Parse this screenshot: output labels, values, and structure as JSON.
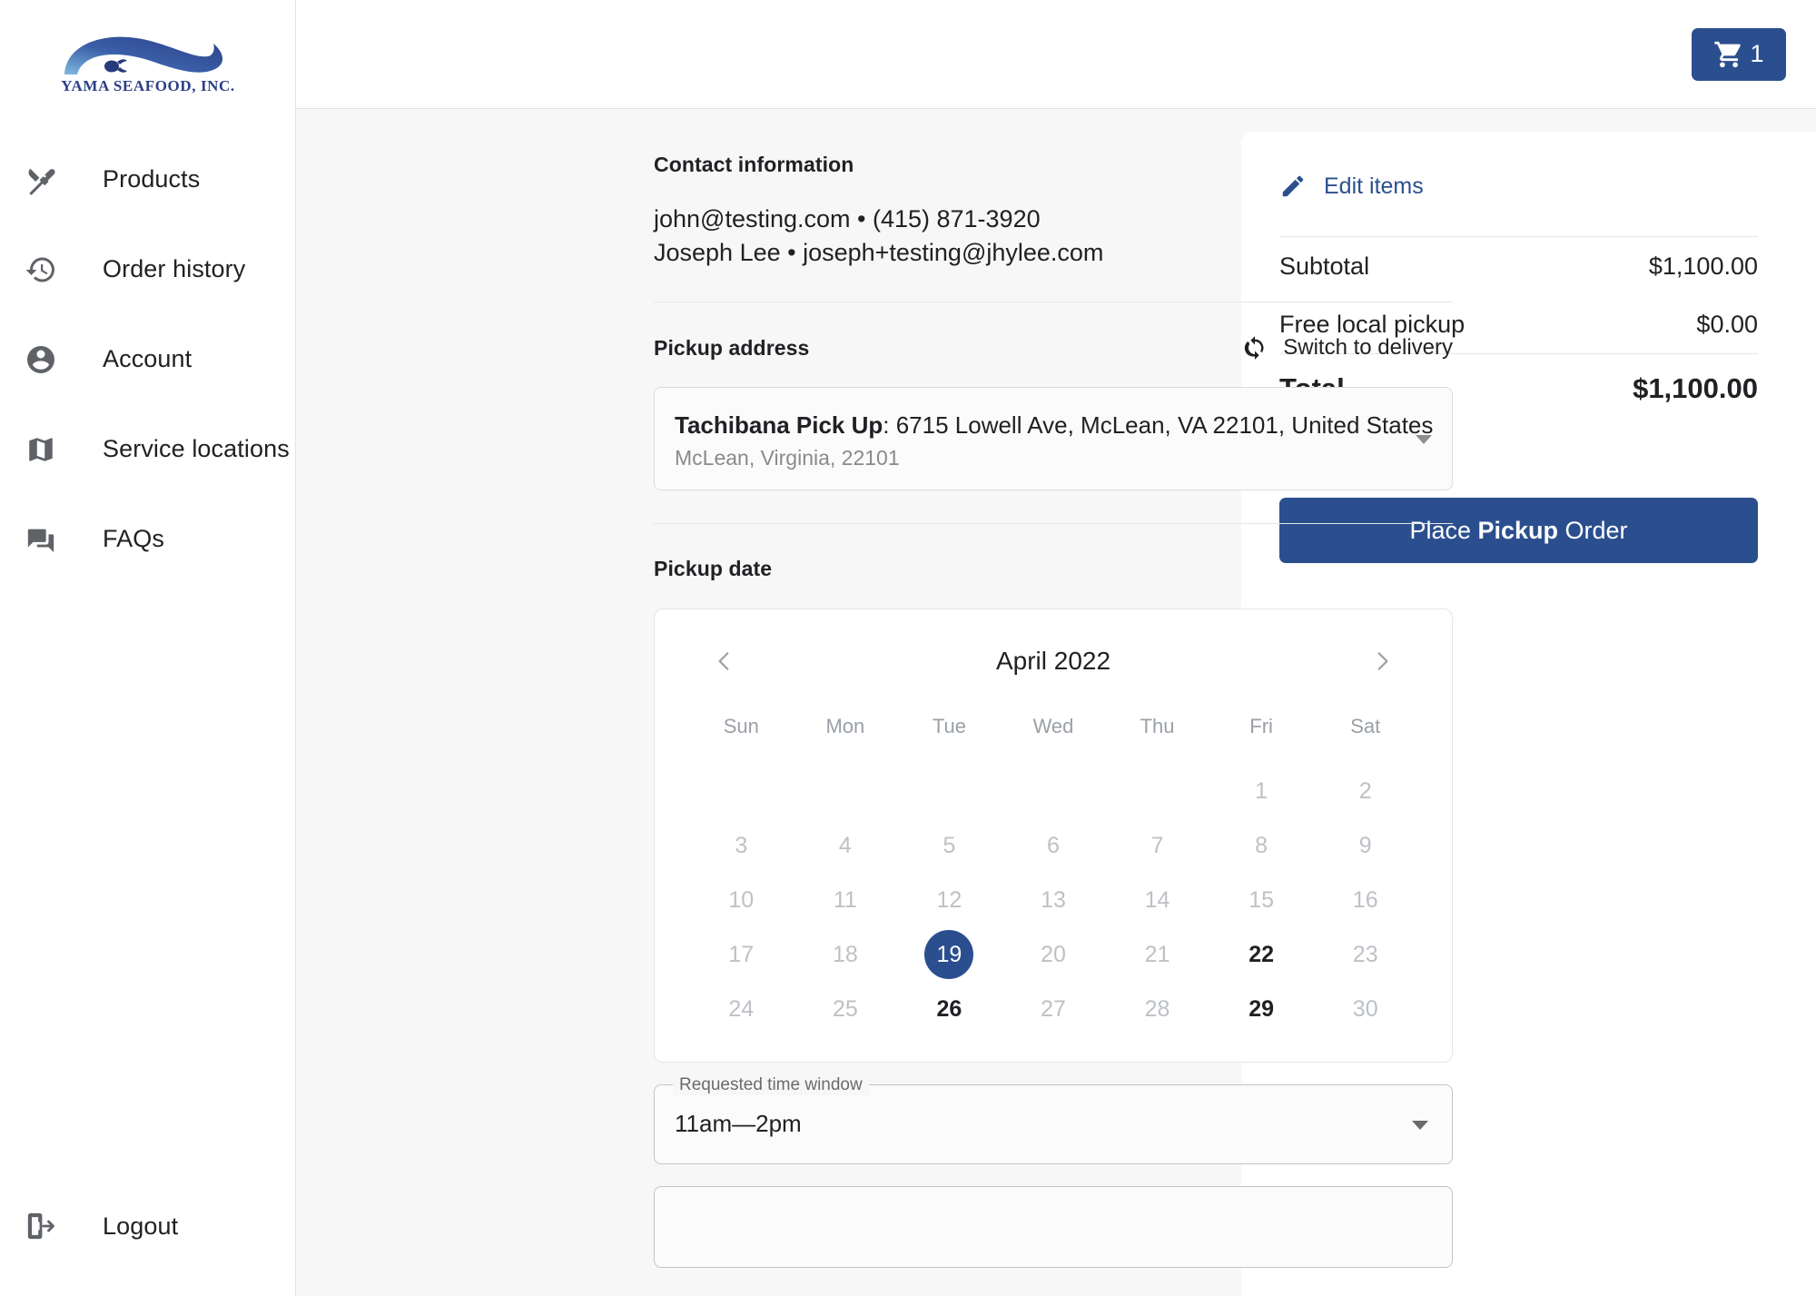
{
  "brand": {
    "logo_text": "YAMA SEAFOOD, INC.",
    "logo_icon": "fish-wave-logo",
    "accent_color": "#2b4f8e"
  },
  "sidebar": {
    "items": [
      {
        "label": "Products",
        "icon": "restaurant-utensils-icon"
      },
      {
        "label": "Order history",
        "icon": "history-clock-icon"
      },
      {
        "label": "Account",
        "icon": "account-circle-icon"
      },
      {
        "label": "Service locations",
        "icon": "map-icon"
      },
      {
        "label": "FAQs",
        "icon": "question-answer-icon"
      }
    ],
    "logout": {
      "label": "Logout",
      "icon": "logout-icon"
    }
  },
  "topbar": {
    "cart": {
      "icon": "shopping-cart-icon",
      "count": "1"
    }
  },
  "checkout": {
    "contact": {
      "title": "Contact information",
      "line1": "john@testing.com • (415) 871-3920",
      "line2": "Joseph Lee • joseph+testing@jhylee.com"
    },
    "pickup_address": {
      "title": "Pickup address",
      "switch_label": "Switch to delivery",
      "switch_icon": "sync-icon",
      "selected_name": "Tachibana Pick Up",
      "selected_address": ": 6715 Lowell Ave, McLean, VA 22101, United States",
      "selected_sub": "McLean, Virginia, 22101",
      "caret_icon": "chevron-down-icon"
    },
    "pickup_date": {
      "title": "Pickup date",
      "month_label": "April 2022",
      "prev_icon": "chevron-left-icon",
      "next_icon": "chevron-right-icon",
      "day_headers": [
        "Sun",
        "Mon",
        "Tue",
        "Wed",
        "Thu",
        "Fri",
        "Sat"
      ],
      "weeks": [
        [
          {
            "d": "",
            "s": "empty"
          },
          {
            "d": "",
            "s": "empty"
          },
          {
            "d": "",
            "s": "empty"
          },
          {
            "d": "",
            "s": "empty"
          },
          {
            "d": "",
            "s": "empty"
          },
          {
            "d": "1",
            "s": "dim"
          },
          {
            "d": "2",
            "s": "dim"
          }
        ],
        [
          {
            "d": "3",
            "s": "dim"
          },
          {
            "d": "4",
            "s": "dim"
          },
          {
            "d": "5",
            "s": "dim"
          },
          {
            "d": "6",
            "s": "dim"
          },
          {
            "d": "7",
            "s": "dim"
          },
          {
            "d": "8",
            "s": "dim"
          },
          {
            "d": "9",
            "s": "dim"
          }
        ],
        [
          {
            "d": "10",
            "s": "dim"
          },
          {
            "d": "11",
            "s": "dim"
          },
          {
            "d": "12",
            "s": "dim"
          },
          {
            "d": "13",
            "s": "dim"
          },
          {
            "d": "14",
            "s": "dim"
          },
          {
            "d": "15",
            "s": "dim"
          },
          {
            "d": "16",
            "s": "dim"
          }
        ],
        [
          {
            "d": "17",
            "s": "dim"
          },
          {
            "d": "18",
            "s": "dim"
          },
          {
            "d": "19",
            "s": "selected"
          },
          {
            "d": "20",
            "s": "dim"
          },
          {
            "d": "21",
            "s": "dim"
          },
          {
            "d": "22",
            "s": "available"
          },
          {
            "d": "23",
            "s": "dim"
          }
        ],
        [
          {
            "d": "24",
            "s": "dim"
          },
          {
            "d": "25",
            "s": "dim"
          },
          {
            "d": "26",
            "s": "available"
          },
          {
            "d": "27",
            "s": "dim"
          },
          {
            "d": "28",
            "s": "dim"
          },
          {
            "d": "29",
            "s": "available"
          },
          {
            "d": "30",
            "s": "dim"
          }
        ]
      ],
      "selected_day": "19"
    },
    "time_window": {
      "label": "Requested time window",
      "value": "11am—2pm",
      "caret_icon": "chevron-down-icon"
    }
  },
  "summary": {
    "edit_items_label": "Edit items",
    "edit_icon": "pencil-icon",
    "rows": [
      {
        "label": "Subtotal",
        "value": "$1,100.00"
      },
      {
        "label": "Free local pickup",
        "value": "$0.00"
      }
    ],
    "total": {
      "label": "Total",
      "value": "$1,100.00"
    },
    "place_order": {
      "prefix": "Place ",
      "strong": "Pickup",
      "suffix": " Order"
    }
  }
}
